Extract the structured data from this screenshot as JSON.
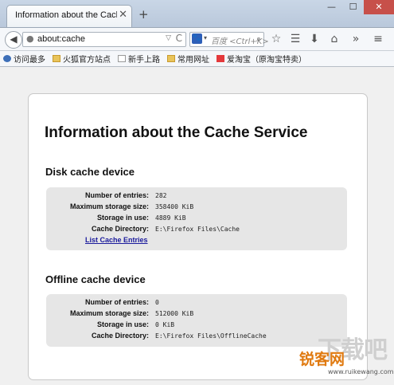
{
  "tab": {
    "title": "Information about the Cache Servi",
    "close_glyph": "✕"
  },
  "new_tab_glyph": "+",
  "window_controls": {
    "minimize": "—",
    "maximize": "☐",
    "close": "✕"
  },
  "nav": {
    "back_glyph": "◀",
    "url": "about:cache",
    "url_globe": "●",
    "url_dropdown": "▽",
    "reload_glyph": "C",
    "search_engine_glyph": "🐾",
    "search_dropdown": "▾",
    "search_placeholder": "百度 <Ctrl+K>",
    "search_go": "⌕",
    "tools": {
      "bookmark_star": "☆",
      "reading_list": "☰",
      "download": "⬇",
      "home": "⌂",
      "overflow": "»",
      "menu": "≡"
    }
  },
  "bookmarks": [
    {
      "icon": "gear-icon",
      "label": "访问最多"
    },
    {
      "icon": "folder-icon",
      "label": "火狐官方站点"
    },
    {
      "icon": "page-icon",
      "label": "新手上路"
    },
    {
      "icon": "folder-icon",
      "label": "常用网址"
    },
    {
      "icon": "taobao-icon",
      "label": "爱淘宝（原淘宝特卖）"
    }
  ],
  "page": {
    "title": "Information about the Cache Service",
    "disk": {
      "heading": "Disk cache device",
      "rows": [
        {
          "key": "Number of entries:",
          "value": "282"
        },
        {
          "key": "Maximum storage size:",
          "value": "358400 KiB"
        },
        {
          "key": "Storage in use:",
          "value": "4889 KiB"
        },
        {
          "key": "Cache Directory:",
          "value": "E:\\Firefox Files\\Cache"
        }
      ],
      "link": "List Cache Entries"
    },
    "offline": {
      "heading": "Offline cache device",
      "rows": [
        {
          "key": "Number of entries:",
          "value": "0"
        },
        {
          "key": "Maximum storage size:",
          "value": "512000 KiB"
        },
        {
          "key": "Storage in use:",
          "value": "0 KiB"
        },
        {
          "key": "Cache Directory:",
          "value": "E:\\Firefox Files\\OfflineCache"
        }
      ]
    }
  },
  "watermark": {
    "big": "下载吧",
    "main": "锐客网",
    "sub": "www.ruikewang.com"
  }
}
